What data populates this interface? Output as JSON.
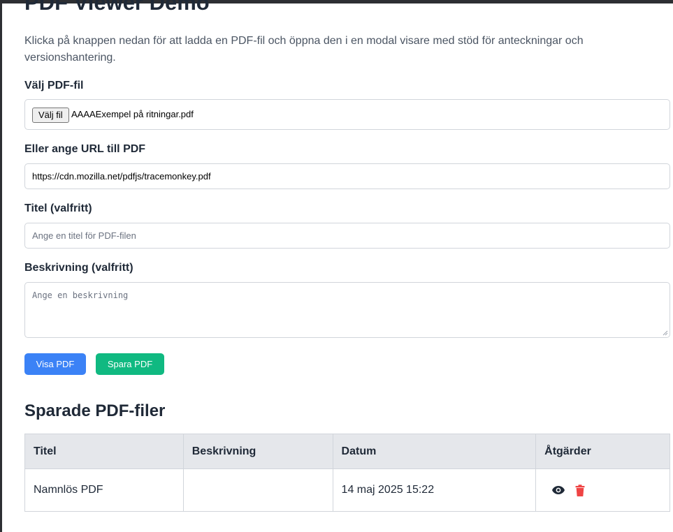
{
  "page": {
    "title": "PDF Viewer Demo",
    "intro": "Klicka på knappen nedan för att ladda en PDF-fil och öppna den i en modal visare med stöd för anteckningar och versionshantering."
  },
  "form": {
    "file_label": "Välj PDF-fil",
    "file_button": "Välj fil",
    "file_name": "AAAAExempel på ritningar.pdf",
    "url_label": "Eller ange URL till PDF",
    "url_value": "https://cdn.mozilla.net/pdfjs/tracemonkey.pdf",
    "title_label": "Titel (valfritt)",
    "title_placeholder": "Ange en titel för PDF-filen",
    "description_label": "Beskrivning (valfritt)",
    "description_placeholder": "Ange en beskrivning",
    "view_button": "Visa PDF",
    "save_button": "Spara PDF"
  },
  "saved": {
    "heading": "Sparade PDF-filer",
    "columns": [
      "Titel",
      "Beskrivning",
      "Datum",
      "Åtgärder"
    ],
    "rows": [
      {
        "title": "Namnlös PDF",
        "description": "",
        "date": "14 maj 2025 15:22",
        "actions": [
          "eye-icon",
          "trash-icon"
        ]
      }
    ]
  },
  "colors": {
    "primary_button": "#3b82f6",
    "success_button": "#10b981",
    "delete_icon": "#ef4444",
    "view_icon": "#1f2937",
    "table_header_bg": "#e5e7eb"
  }
}
